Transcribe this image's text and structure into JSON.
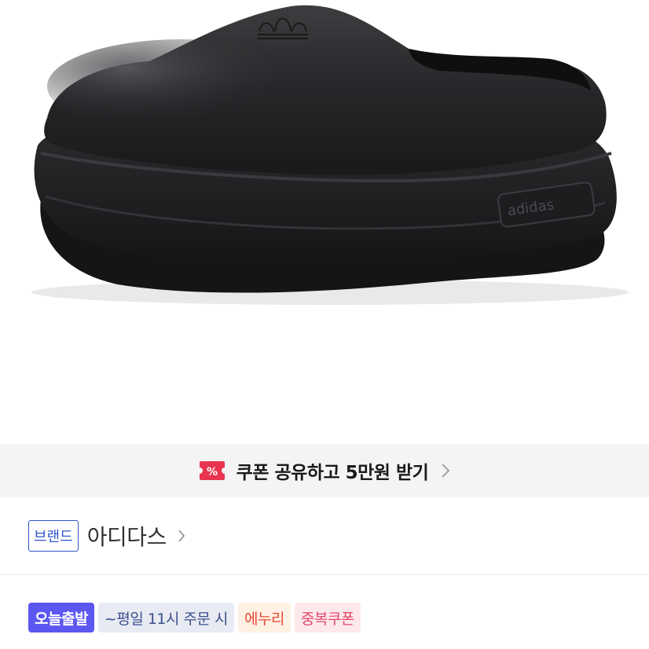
{
  "product": {
    "image_alt": "black clog shoe",
    "sole_logo_text": "adidas"
  },
  "coupon_bar": {
    "icon_symbol": "%",
    "text": "쿠폰 공유하고 5만원 받기",
    "accent_color": "#e8344f"
  },
  "brand": {
    "badge": "브랜드",
    "name": "아디다스",
    "badge_color": "#2f56c9"
  },
  "tags": [
    {
      "label": "오늘출발"
    },
    {
      "label": "~평일 11시 주문 시"
    },
    {
      "label": "에누리"
    },
    {
      "label": "중복쿠폰"
    }
  ]
}
